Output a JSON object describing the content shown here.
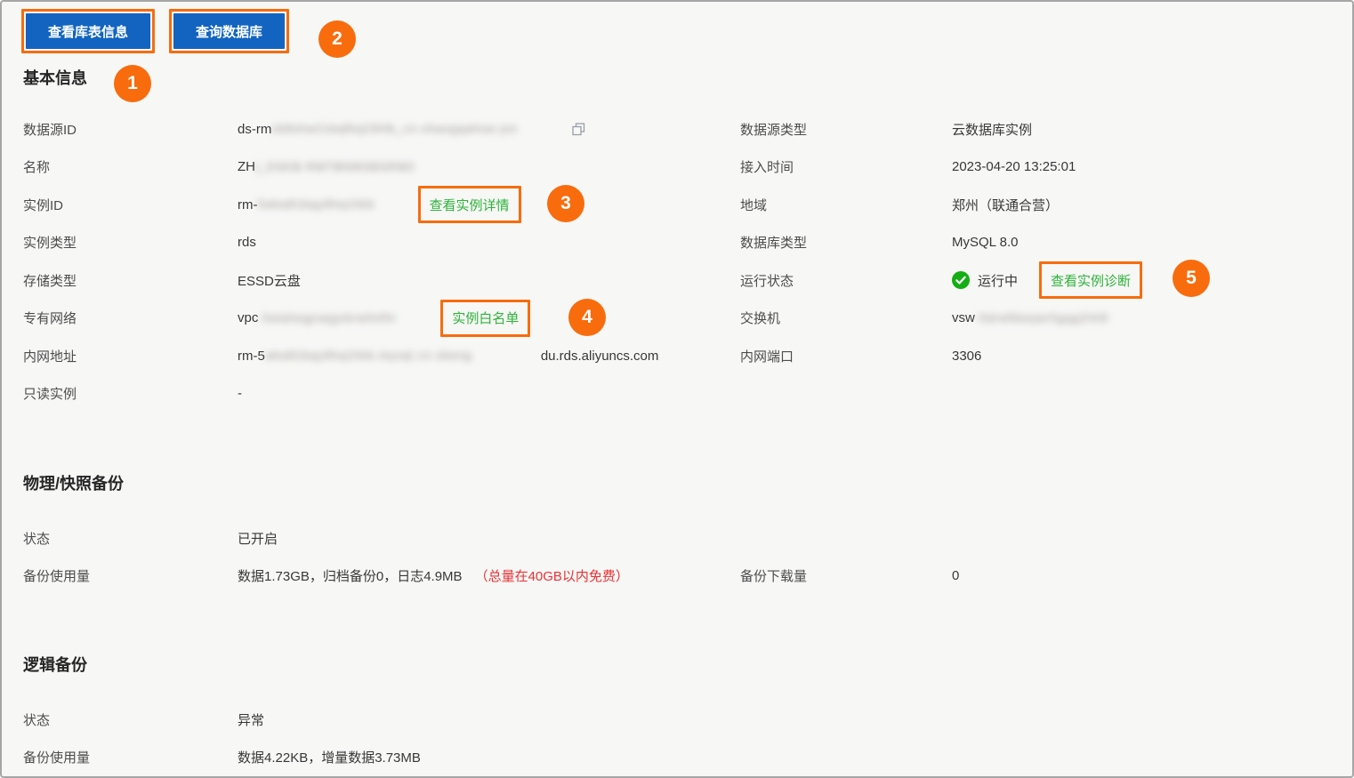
{
  "toolbar": {
    "view_tables_label": "查看库表信息",
    "query_db_label": "查询数据库"
  },
  "callouts": {
    "c1": "1",
    "c2": "2",
    "c3": "3",
    "c4": "4",
    "c5": "5"
  },
  "basic": {
    "title": "基本信息",
    "rows": {
      "datasource_id": {
        "label": "数据源ID",
        "prefix": "ds-rm",
        "blur": "xk8shw21bqfkq23hlb_cn-xhangqahsw-jsn"
      },
      "name": {
        "label": "名称",
        "prefix": "ZH",
        "blur": "|_DSKB-RMTBNMSBSRM2"
      },
      "instance_id": {
        "label": "实例ID",
        "prefix": "rm-",
        "blur": "5wka81bqy9hq1hkb",
        "link": "查看实例详情"
      },
      "instance_type": {
        "label": "实例类型",
        "value": "rds"
      },
      "storage_type": {
        "label": "存储类型",
        "value": "ESSD云盘"
      },
      "vpc": {
        "label": "专有网络",
        "prefix": "vpc",
        "blur": "-5alahegjrwjgvbrw0sfhr",
        "link": "实例白名单"
      },
      "intranet_addr": {
        "label": "内网地址",
        "prefix": "rm-5",
        "blur": "wka81bqy9hq1hkb.mysql.cn-zbeng",
        "suffix": "du.rds.aliyuncs.com"
      },
      "readonly": {
        "label": "只读实例",
        "value": "-"
      },
      "datasource_type": {
        "label": "数据源类型",
        "value": "云数据库实例"
      },
      "access_time": {
        "label": "接入时间",
        "value": "2023-04-20 13:25:01"
      },
      "region": {
        "label": "地域",
        "value": "郑州（联通合营）"
      },
      "db_type": {
        "label": "数据库类型",
        "value": "MySQL 8.0"
      },
      "run_status": {
        "label": "运行状态",
        "value": "运行中",
        "link": "查看实例诊断"
      },
      "vswitch": {
        "label": "交换机",
        "prefix": "vsw",
        "blur": "-5drwfkkejwr5gqg2l43l"
      },
      "intranet_port": {
        "label": "内网端口",
        "value": "3306"
      }
    }
  },
  "physical_backup": {
    "title": "物理/快照备份",
    "status_label": "状态",
    "status_value": "已开启",
    "usage_label": "备份使用量",
    "usage_value": "数据1.73GB，归档备份0，日志4.9MB",
    "usage_note": "（总量在40GB以内免费）",
    "download_label": "备份下载量",
    "download_value": "0"
  },
  "logical_backup": {
    "title": "逻辑备份",
    "status_label": "状态",
    "status_value": "异常",
    "usage_label": "备份使用量",
    "usage_value": "数据4.22KB，增量数据3.73MB"
  },
  "colors": {
    "accent_blue": "#1264c0",
    "annotation_orange": "#f86c0d",
    "link_green": "#2eb33a",
    "status_green": "#14ad14",
    "note_red": "#eb3232"
  }
}
